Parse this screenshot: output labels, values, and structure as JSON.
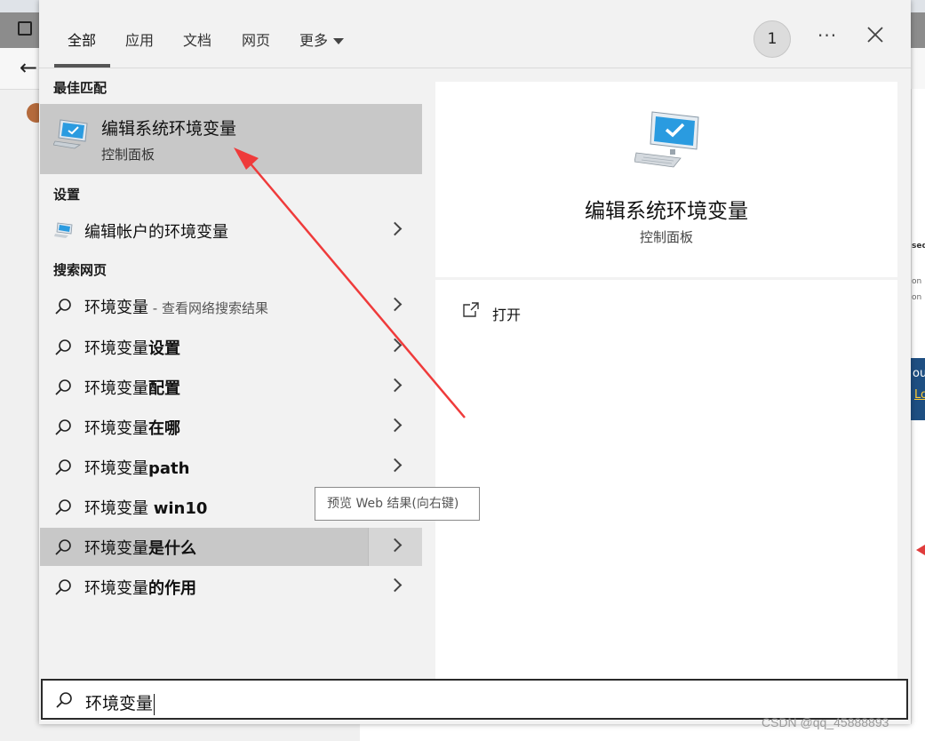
{
  "browser": {
    "back_glyph": "←",
    "right_strip": {
      "t1": "sed",
      "t2": "on",
      "t3": "on",
      "b1": "ou",
      "b2": "Lo"
    }
  },
  "flyout": {
    "tabs": [
      {
        "label": "全部",
        "active": true
      },
      {
        "label": "应用"
      },
      {
        "label": "文档"
      },
      {
        "label": "网页"
      },
      {
        "label": "更多"
      }
    ],
    "badge": "1",
    "more_dots": "···",
    "sections": {
      "best_match": "最佳匹配",
      "settings": "设置",
      "web": "搜索网页"
    },
    "best_match": {
      "title": "编辑系统环境变量",
      "subtitle": "控制面板",
      "icon": "computer-monitor-icon"
    },
    "settings_item": {
      "label": "编辑帐户的环境变量",
      "icon": "computer-monitor-icon"
    },
    "web_results": [
      {
        "normal": "环境变量",
        "bold": "",
        "hint": " - 查看网络搜索结果"
      },
      {
        "normal": "环境变量",
        "bold": "设置",
        "hint": ""
      },
      {
        "normal": "环境变量",
        "bold": "配置",
        "hint": ""
      },
      {
        "normal": "环境变量",
        "bold": "在哪",
        "hint": ""
      },
      {
        "normal": "环境变量",
        "bold": "path",
        "hint": ""
      },
      {
        "normal": "环境变量 ",
        "bold": "win10",
        "hint": ""
      },
      {
        "normal": "环境变量",
        "bold": "是什么",
        "hint": "",
        "highlighted": true
      },
      {
        "normal": "环境变量",
        "bold": "的作用",
        "hint": ""
      }
    ],
    "detail": {
      "title": "编辑系统环境变量",
      "subtitle": "控制面板",
      "open_label": "打开"
    },
    "tooltip": "预览 Web 结果(向右键)",
    "search": {
      "value": "环境变量"
    }
  },
  "watermark": "CSDN @qq_45888893",
  "colors": {
    "annotation_arrow": "#ef3b3b",
    "selection": "#c8c8c8",
    "pane": "#f2f2f2"
  }
}
